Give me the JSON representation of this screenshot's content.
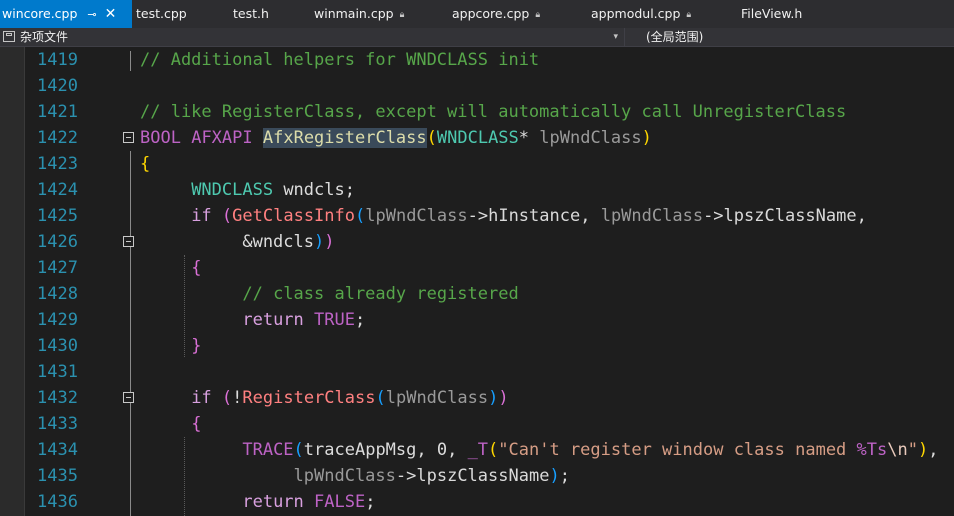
{
  "tabs": [
    {
      "label": "wincore.cpp",
      "active": true,
      "pin_icon": "pin-icon",
      "close_icon": "close-icon"
    },
    {
      "label": "test.cpp",
      "locked": false
    },
    {
      "label": "test.h",
      "locked": false
    },
    {
      "label": "winmain.cpp",
      "locked": true
    },
    {
      "label": "appcore.cpp",
      "locked": true
    },
    {
      "label": "appmodul.cpp",
      "locked": true
    },
    {
      "label": "FileView.h",
      "locked": false
    }
  ],
  "navbar": {
    "scope": "杂项文件",
    "member": "(全局范围)"
  },
  "code": {
    "lines": [
      {
        "num": "1419",
        "tokens": [
          [
            "cmt",
            "// Additional helpers for WNDCLASS init"
          ]
        ]
      },
      {
        "num": "1420",
        "tokens": []
      },
      {
        "num": "1421",
        "tokens": [
          [
            "cmt",
            "// like RegisterClass, except will automatically call UnregisterClass"
          ]
        ]
      },
      {
        "num": "1422",
        "tokens": [
          [
            "mac",
            "BOOL"
          ],
          [
            "",
            " "
          ],
          [
            "mac",
            "AFXAPI"
          ],
          [
            "",
            " "
          ],
          [
            "hlfn",
            "AfxRegisterClass"
          ],
          [
            "br1",
            "("
          ],
          [
            "ty",
            "WNDCLASS"
          ],
          [
            "",
            "* "
          ],
          [
            "pm",
            "lpWndClass"
          ],
          [
            "br1",
            ")"
          ]
        ]
      },
      {
        "num": "1423",
        "tokens": [
          [
            "br1",
            "{"
          ]
        ]
      },
      {
        "num": "1424",
        "tokens": [
          [
            "",
            "     "
          ],
          [
            "ty",
            "WNDCLASS"
          ],
          [
            "",
            " wndcls;"
          ]
        ]
      },
      {
        "num": "1425",
        "tokens": [
          [
            "",
            "     "
          ],
          [
            "ctl",
            "if"
          ],
          [
            "",
            " "
          ],
          [
            "br2",
            "("
          ],
          [
            "fnm",
            "GetClassInfo"
          ],
          [
            "br3",
            "("
          ],
          [
            "pm",
            "lpWndClass"
          ],
          [
            "",
            "->"
          ],
          [
            "mem",
            "hInstance"
          ],
          [
            "",
            ", "
          ],
          [
            "pm",
            "lpWndClass"
          ],
          [
            "",
            "->"
          ],
          [
            "mem",
            "lpszClassName"
          ],
          [
            "",
            ","
          ]
        ]
      },
      {
        "num": "1426",
        "tokens": [
          [
            "",
            "          &wndcls"
          ],
          [
            "br3",
            ")"
          ],
          [
            "br2",
            ")"
          ]
        ]
      },
      {
        "num": "1427",
        "tokens": [
          [
            "",
            "     "
          ],
          [
            "br2",
            "{"
          ]
        ]
      },
      {
        "num": "1428",
        "tokens": [
          [
            "",
            "          "
          ],
          [
            "cmt",
            "// class already registered"
          ]
        ]
      },
      {
        "num": "1429",
        "tokens": [
          [
            "",
            "          "
          ],
          [
            "ctl",
            "return"
          ],
          [
            "",
            " "
          ],
          [
            "mac",
            "TRUE"
          ],
          [
            "",
            ";"
          ]
        ]
      },
      {
        "num": "1430",
        "tokens": [
          [
            "",
            "     "
          ],
          [
            "br2",
            "}"
          ]
        ]
      },
      {
        "num": "1431",
        "tokens": []
      },
      {
        "num": "1432",
        "tokens": [
          [
            "",
            "     "
          ],
          [
            "ctl",
            "if"
          ],
          [
            "",
            " "
          ],
          [
            "br2",
            "("
          ],
          [
            "",
            "!"
          ],
          [
            "fnm",
            "RegisterClass"
          ],
          [
            "br3",
            "("
          ],
          [
            "pm",
            "lpWndClass"
          ],
          [
            "br3",
            ")"
          ],
          [
            "br2",
            ")"
          ]
        ]
      },
      {
        "num": "1433",
        "tokens": [
          [
            "",
            "     "
          ],
          [
            "br2",
            "{"
          ]
        ]
      },
      {
        "num": "1434",
        "tokens": [
          [
            "",
            "          "
          ],
          [
            "mac",
            "TRACE"
          ],
          [
            "br3",
            "("
          ],
          [
            "",
            "traceAppMsg, 0, "
          ],
          [
            "mac",
            "_T"
          ],
          [
            "br1",
            "("
          ],
          [
            "str",
            "\"Can't register window class named "
          ],
          [
            "mac",
            "%Ts"
          ],
          [
            "esc",
            "\\n"
          ],
          [
            "str",
            "\""
          ],
          [
            "br1",
            ")"
          ],
          [
            "",
            ","
          ]
        ]
      },
      {
        "num": "1435",
        "tokens": [
          [
            "",
            "               "
          ],
          [
            "pm",
            "lpWndClass"
          ],
          [
            "",
            "->"
          ],
          [
            "mem",
            "lpszClassName"
          ],
          [
            "br3",
            ")"
          ],
          [
            "",
            ";"
          ]
        ]
      },
      {
        "num": "1436",
        "tokens": [
          [
            "",
            "          "
          ],
          [
            "ctl",
            "return"
          ],
          [
            "",
            " "
          ],
          [
            "mac",
            "FALSE"
          ],
          [
            "",
            ";"
          ]
        ]
      }
    ]
  },
  "colors": {
    "background": "#1e1e1e",
    "line_number": "#2b91af",
    "comment": "#57a64a",
    "tab_active": "#007acc"
  }
}
